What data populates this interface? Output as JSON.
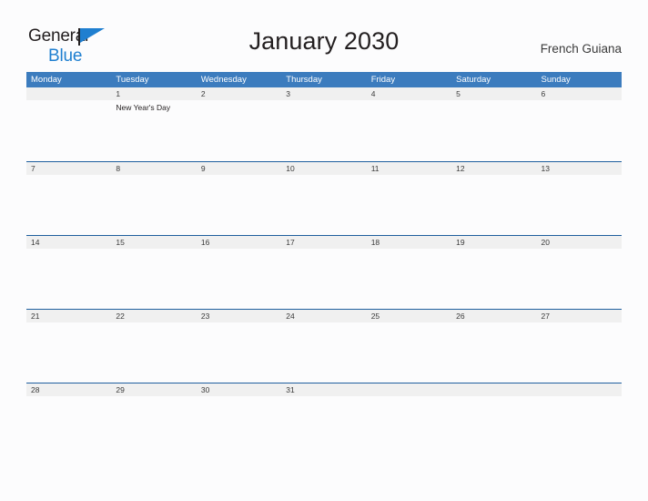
{
  "brand": {
    "word1": "General",
    "word2": "Blue",
    "accent_color": "#1f7fd0",
    "flag_icon": "flag-triangle-icon"
  },
  "header": {
    "title": "January 2030",
    "region": "French Guiana"
  },
  "calendar": {
    "header_color": "#3c7cbe",
    "row_rule_color": "#1f5f9e",
    "date_strip_color": "#f0f0f0",
    "weekdays": [
      "Monday",
      "Tuesday",
      "Wednesday",
      "Thursday",
      "Friday",
      "Saturday",
      "Sunday"
    ],
    "weeks": [
      {
        "days": [
          {
            "date": "",
            "event": ""
          },
          {
            "date": "1",
            "event": "New Year's Day"
          },
          {
            "date": "2",
            "event": ""
          },
          {
            "date": "3",
            "event": ""
          },
          {
            "date": "4",
            "event": ""
          },
          {
            "date": "5",
            "event": ""
          },
          {
            "date": "6",
            "event": ""
          }
        ]
      },
      {
        "days": [
          {
            "date": "7",
            "event": ""
          },
          {
            "date": "8",
            "event": ""
          },
          {
            "date": "9",
            "event": ""
          },
          {
            "date": "10",
            "event": ""
          },
          {
            "date": "11",
            "event": ""
          },
          {
            "date": "12",
            "event": ""
          },
          {
            "date": "13",
            "event": ""
          }
        ]
      },
      {
        "days": [
          {
            "date": "14",
            "event": ""
          },
          {
            "date": "15",
            "event": ""
          },
          {
            "date": "16",
            "event": ""
          },
          {
            "date": "17",
            "event": ""
          },
          {
            "date": "18",
            "event": ""
          },
          {
            "date": "19",
            "event": ""
          },
          {
            "date": "20",
            "event": ""
          }
        ]
      },
      {
        "days": [
          {
            "date": "21",
            "event": ""
          },
          {
            "date": "22",
            "event": ""
          },
          {
            "date": "23",
            "event": ""
          },
          {
            "date": "24",
            "event": ""
          },
          {
            "date": "25",
            "event": ""
          },
          {
            "date": "26",
            "event": ""
          },
          {
            "date": "27",
            "event": ""
          }
        ]
      },
      {
        "days": [
          {
            "date": "28",
            "event": ""
          },
          {
            "date": "29",
            "event": ""
          },
          {
            "date": "30",
            "event": ""
          },
          {
            "date": "31",
            "event": ""
          },
          {
            "date": "",
            "event": ""
          },
          {
            "date": "",
            "event": ""
          },
          {
            "date": "",
            "event": ""
          }
        ]
      }
    ]
  }
}
